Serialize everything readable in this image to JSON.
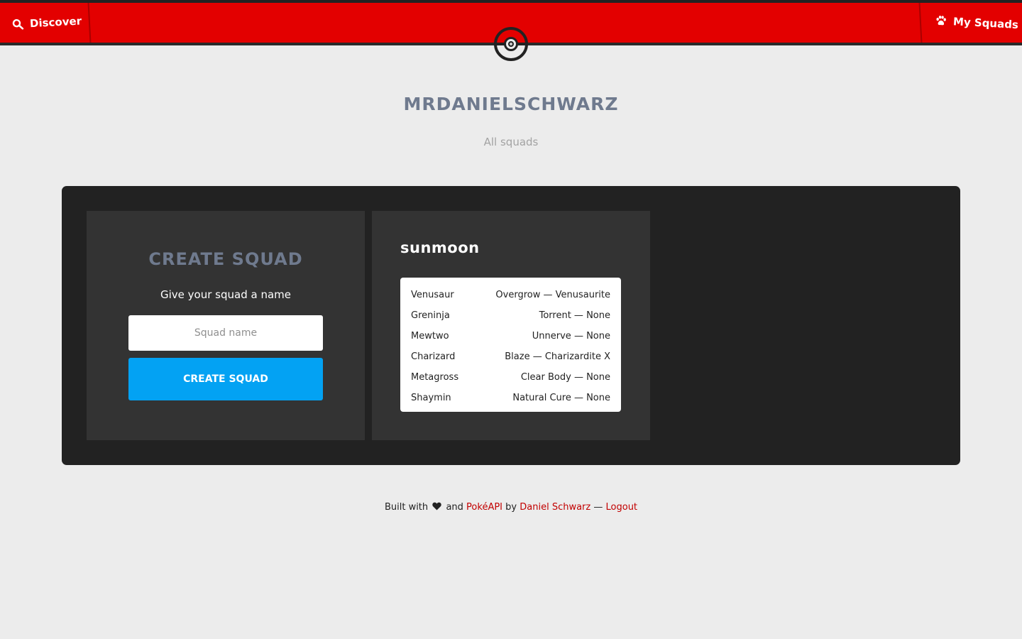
{
  "header": {
    "discover_label": "Discover",
    "my_squads_label": "My Squads",
    "discover_icon": "search-icon",
    "my_squads_icon": "paw-icon",
    "logo_icon": "pokeball-icon",
    "accent_color": "#e30000"
  },
  "profile": {
    "username": "MRDANIELSCHWARZ",
    "subtitle": "All squads"
  },
  "create_squad": {
    "title": "CREATE SQUAD",
    "hint": "Give your squad a name",
    "input_placeholder": "Squad name",
    "input_value": "",
    "button_label": "CREATE SQUAD",
    "button_color": "#03a2f3"
  },
  "squads": [
    {
      "name": "sunmoon",
      "members": [
        {
          "pokemon": "Venusaur",
          "details": "Overgrow — Venusaurite"
        },
        {
          "pokemon": "Greninja",
          "details": "Torrent — None"
        },
        {
          "pokemon": "Mewtwo",
          "details": "Unnerve — None"
        },
        {
          "pokemon": "Charizard",
          "details": "Blaze — Charizardite X"
        },
        {
          "pokemon": "Metagross",
          "details": "Clear Body — None"
        },
        {
          "pokemon": "Shaymin",
          "details": "Natural Cure — None"
        }
      ]
    }
  ],
  "footer": {
    "built_with": "Built with",
    "and": "and",
    "pokeapi_link": "PokéAPI",
    "by": "by",
    "author_link": "Daniel Schwarz",
    "dash": "—",
    "logout_link": "Logout",
    "heart_icon": "heart-icon"
  }
}
